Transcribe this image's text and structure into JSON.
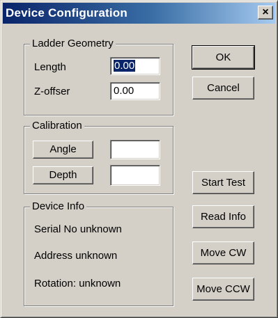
{
  "window": {
    "title": "Device Configuration",
    "close_glyph": "×"
  },
  "ladder_geometry": {
    "legend": "Ladder Geometry",
    "length_label": "Length",
    "length_value": "0.00",
    "zoffset_label": "Z-offser",
    "zoffset_value": "0.00"
  },
  "calibration": {
    "legend": "Calibration",
    "angle_button": "Angle",
    "angle_value": "",
    "depth_button": "Depth",
    "depth_value": ""
  },
  "device_info": {
    "legend": "Device Info",
    "serial": "Serial No unknown",
    "address": "Address unknown",
    "rotation": "Rotation: unknown"
  },
  "buttons": {
    "ok": "OK",
    "cancel": "Cancel",
    "start_test": "Start Test",
    "read_info": "Read Info",
    "move_cw": "Move CW",
    "move_ccw": "Move CCW"
  },
  "colors": {
    "dialog_face": "#d4d0c8",
    "title_active": "#0a246a",
    "selection": "#0a246a"
  }
}
